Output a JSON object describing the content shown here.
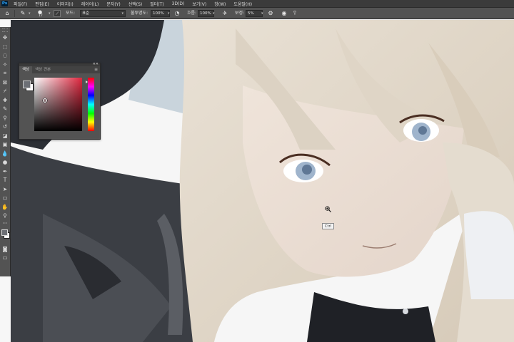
{
  "app": {
    "logo": "Ps"
  },
  "menu": [
    "파일(F)",
    "편집(E)",
    "이미지(I)",
    "레이어(L)",
    "문자(Y)",
    "선택(S)",
    "필터(T)",
    "3D(D)",
    "보기(V)",
    "창(W)",
    "도움말(H)"
  ],
  "options": {
    "brush_size": "17",
    "mode_label": "모드:",
    "mode_value": "표준",
    "opacity_label": "불투명도:",
    "opacity_value": "100%",
    "flow_label": "흐름:",
    "flow_value": "100%",
    "smoothing_label": "보정:",
    "smoothing_value": "5%",
    "icons": [
      "home-icon",
      "brush-icon",
      "brush-preset-icon",
      "brush-settings-icon",
      "pressure-opacity-icon",
      "airbrush-icon",
      "smoothing-options-icon",
      "pressure-size-icon",
      "symmetry-icon"
    ]
  },
  "toolbar": {
    "tools": [
      {
        "name": "move-tool-icon",
        "glyph": "✥"
      },
      {
        "name": "marquee-tool-icon",
        "glyph": "⬚"
      },
      {
        "name": "lasso-tool-icon",
        "glyph": "◌"
      },
      {
        "name": "magic-wand-tool-icon",
        "glyph": "✧"
      },
      {
        "name": "crop-tool-icon",
        "glyph": "⌗"
      },
      {
        "name": "frame-tool-icon",
        "glyph": "⊠"
      },
      {
        "name": "eyedropper-tool-icon",
        "glyph": "⌿"
      },
      {
        "name": "healing-brush-tool-icon",
        "glyph": "✚"
      },
      {
        "name": "brush-tool-icon",
        "glyph": "✎"
      },
      {
        "name": "clone-stamp-tool-icon",
        "glyph": "⚲"
      },
      {
        "name": "history-brush-tool-icon",
        "glyph": "↺"
      },
      {
        "name": "eraser-tool-icon",
        "glyph": "◪"
      },
      {
        "name": "gradient-tool-icon",
        "glyph": "▣"
      },
      {
        "name": "blur-tool-icon",
        "glyph": "💧"
      },
      {
        "name": "dodge-tool-icon",
        "glyph": "●"
      },
      {
        "name": "pen-tool-icon",
        "glyph": "✒"
      },
      {
        "name": "type-tool-icon",
        "glyph": "T"
      },
      {
        "name": "path-selection-tool-icon",
        "glyph": "➤"
      },
      {
        "name": "shape-tool-icon",
        "glyph": "▭"
      },
      {
        "name": "hand-tool-icon",
        "glyph": "✋"
      },
      {
        "name": "zoom-tool-icon",
        "glyph": "⚲"
      },
      {
        "name": "more-tools-icon",
        "glyph": "…"
      }
    ],
    "lower": [
      {
        "name": "quick-mask-icon",
        "glyph": "◙"
      },
      {
        "name": "screen-mode-icon",
        "glyph": "▭"
      }
    ],
    "foreground_color": "#6c6f75",
    "background_color": "#ffffff"
  },
  "color_panel": {
    "tabs": [
      "색상",
      "색상 견본"
    ],
    "active_tab": 0,
    "hue_color": "#e0273f",
    "close_glyph": "✕✕",
    "menu_glyph": "≡"
  },
  "tooltip": "Ctrl"
}
